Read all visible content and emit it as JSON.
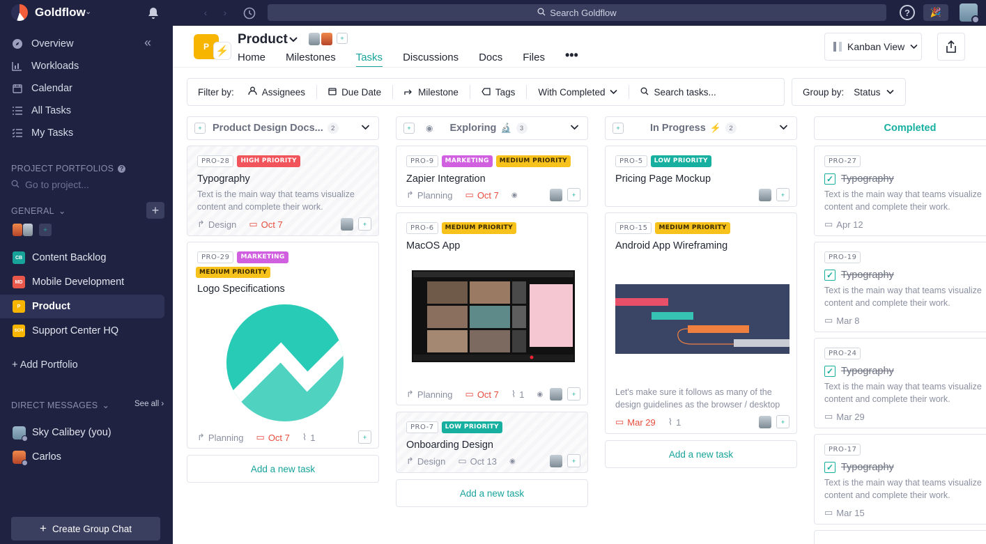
{
  "topbar": {
    "brand": "Goldflow",
    "search_placeholder": "Search Goldflow"
  },
  "sidebar": {
    "nav": [
      {
        "label": "Overview",
        "icon": "compass-icon"
      },
      {
        "label": "Workloads",
        "icon": "bar-chart-icon"
      },
      {
        "label": "Calendar",
        "icon": "calendar-icon"
      },
      {
        "label": "All Tasks",
        "icon": "list-icon"
      },
      {
        "label": "My Tasks",
        "icon": "checklist-icon"
      }
    ],
    "portfolios_label": "PROJECT PORTFOLIOS",
    "goto_placeholder": "Go to project...",
    "general_label": "GENERAL",
    "projects": [
      {
        "label": "Content Backlog",
        "badge": "CB",
        "color": "#17a39a"
      },
      {
        "label": "Mobile Development",
        "badge": "MD",
        "color": "#e8574a"
      },
      {
        "label": "Product",
        "badge": "P",
        "color": "#f7b500"
      },
      {
        "label": "Support Center HQ",
        "badge": "SCH",
        "color": "#f7b500"
      }
    ],
    "add_portfolio": "+ Add Portfolio",
    "dm_label": "DIRECT MESSAGES",
    "see_all": "See all",
    "dms": [
      {
        "name": "Sky Calibey (you)"
      },
      {
        "name": "Carlos"
      }
    ],
    "create_group_chat": "Create Group Chat"
  },
  "project": {
    "logo_letter": "P",
    "title": "Product",
    "tabs": [
      "Home",
      "Milestones",
      "Tasks",
      "Discussions",
      "Docs",
      "Files"
    ],
    "active_tab": "Tasks",
    "view": "Kanban View"
  },
  "filters": {
    "label": "Filter by:",
    "items": [
      "Assignees",
      "Due Date",
      "Milestone",
      "Tags",
      "With Completed"
    ],
    "search_placeholder": "Search tasks...",
    "group_label": "Group by:",
    "group_value": "Status"
  },
  "columns": [
    {
      "title": "Product Design Docs...",
      "count": "2",
      "cards": [
        {
          "id": "PRO-28",
          "tags": [
            "HIGH PRIORITY"
          ],
          "title": "Typography",
          "desc": "Text is the main way that teams visualize content and complete their work.",
          "milestone": "Design",
          "date": "Oct 7"
        },
        {
          "id": "PRO-29",
          "tags": [
            "MARKETING",
            "MEDIUM PRIORITY"
          ],
          "title": "Logo Specifications",
          "milestone": "Planning",
          "date": "Oct 7",
          "attachments": "1"
        }
      ],
      "add_task": "Add a new task"
    },
    {
      "title": "Exploring",
      "count": "3",
      "cards": [
        {
          "id": "PRO-9",
          "tags": [
            "MARKETING",
            "MEDIUM PRIORITY"
          ],
          "title": "Zapier Integration",
          "milestone": "Planning",
          "date": "Oct 7"
        },
        {
          "id": "PRO-6",
          "tags": [
            "MEDIUM PRIORITY"
          ],
          "title": "MacOS App",
          "milestone": "Planning",
          "date": "Oct 7",
          "attachments": "1"
        },
        {
          "id": "PRO-7",
          "tags": [
            "LOW PRIORITY"
          ],
          "title": "Onboarding Design",
          "milestone": "Design",
          "date": "Oct 13"
        }
      ],
      "add_task": "Add a new task"
    },
    {
      "title": "In Progress",
      "count": "2",
      "cards": [
        {
          "id": "PRO-5",
          "tags": [
            "LOW PRIORITY"
          ],
          "title": "Pricing Page Mockup"
        },
        {
          "id": "PRO-15",
          "tags": [
            "MEDIUM PRIORITY"
          ],
          "title": "Android App Wireframing",
          "desc": "Let's make sure it follows as many of the design guidelines as the browser / desktop",
          "date": "Mar 29",
          "attachments": "1"
        }
      ],
      "add_task": "Add a new task"
    },
    {
      "title": "Completed",
      "cards": [
        {
          "id": "PRO-27",
          "title": "Typography",
          "desc": "Text is the main way that teams visualize content and complete their work.",
          "date": "Apr 12"
        },
        {
          "id": "PRO-19",
          "title": "Typography",
          "desc": "Text is the main way that teams visualize content and complete their work.",
          "date": "Mar 8"
        },
        {
          "id": "PRO-24",
          "title": "Typography",
          "desc": "Text is the main way that teams visualize content and complete their work.",
          "date": "Mar 29"
        },
        {
          "id": "PRO-17",
          "title": "Typography",
          "desc": "Text is the main way that teams visualize content and complete their work.",
          "date": "Mar 15"
        }
      ]
    }
  ],
  "colors": {
    "accent": "#17a39a",
    "sidebar": "#1f2240",
    "high": "#f2545b",
    "medium": "#f7c21b",
    "low": "#17b0a0",
    "marketing": "#d060e0"
  }
}
